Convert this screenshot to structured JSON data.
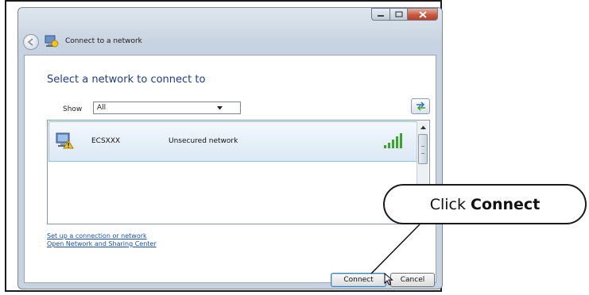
{
  "window": {
    "title": "Connect to a network",
    "controls": {
      "minimize": "minimize",
      "maximize": "maximize",
      "close": "close"
    }
  },
  "content": {
    "heading": "Select a network to connect to",
    "show_label": "Show",
    "show_value": "All"
  },
  "networks": [
    {
      "name": "ECSXXX",
      "security": "Unsecured network"
    }
  ],
  "links": {
    "setup": "Set up a connection or network",
    "sharing_center": "Open Network and Sharing Center"
  },
  "buttons": {
    "connect": "Connect",
    "cancel": "Cancel"
  },
  "callout": {
    "prefix": "Click",
    "emphasis": "Connect"
  },
  "colors": {
    "heading": "#1e3c8c",
    "link": "#1c4fa8",
    "signal": "#3aa52a"
  }
}
